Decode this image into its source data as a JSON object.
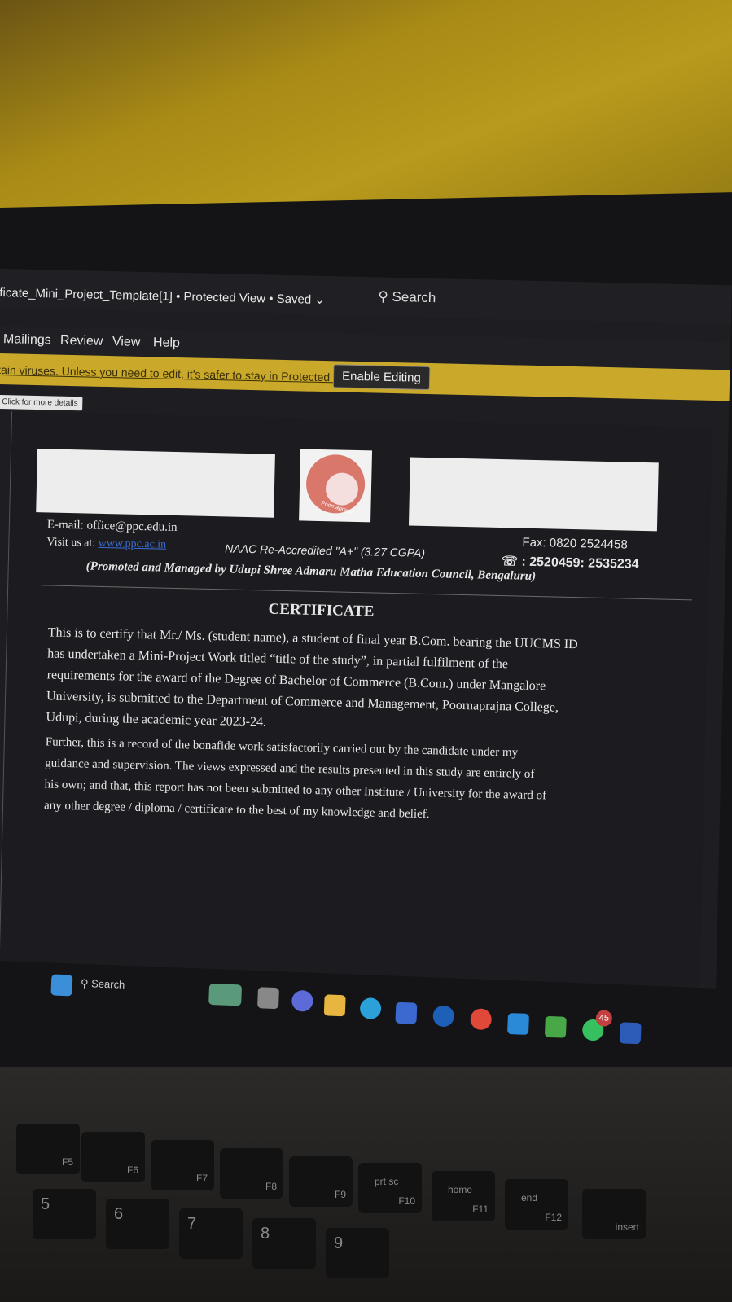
{
  "window": {
    "doc_title": "ficate_Mini_Project_Template[1]",
    "view_mode": "Protected View",
    "save_status": "Saved",
    "search_label": "Search"
  },
  "ribbon": {
    "tabs": [
      "Mailings",
      "Review",
      "View",
      "Help"
    ]
  },
  "protected_bar": {
    "message": "tain viruses. Unless you need to edit, it's safer to stay in Protected View.",
    "enable_button": "Enable Editing"
  },
  "tooltip": "Click for more details",
  "letterhead": {
    "email": "E-mail: office@ppc.edu.in",
    "visit_prefix": "Visit us at:",
    "website": "www.ppc.ac.in",
    "naac": "NAAC Re-Accredited \"A+\" (3.27 CGPA)",
    "fax": "Fax: 0820 2524458",
    "phone": ": 2520459: 2535234",
    "promoted": "(Promoted and Managed by Udupi Shree Admaru Matha Education Council, Bengaluru)",
    "seal_text": "Poornaprajna"
  },
  "certificate": {
    "title": "CERTIFICATE",
    "para1_lines": [
      "This is to certify that Mr./ Ms. (student name), a student of final year B.Com. bearing the UUCMS ID",
      "has undertaken a Mini-Project Work titled “title of the study”, in partial fulfilment of the",
      "requirements for the award of the Degree of Bachelor of Commerce (B.Com.) under Mangalore",
      "University, is submitted to the Department of Commerce and Management, Poornaprajna College,",
      "Udupi, during the academic year 2023-24."
    ],
    "para2_lines": [
      "Further, this is a record of the bonafide work satisfactorily carried out by the candidate under my",
      "guidance and supervision. The views expressed and the results presented in this study are entirely of",
      "his own; and that, this report has not been submitted to any other Institute / University for the award of",
      "any other degree / diploma / certificate to the best of my knowledge and belief."
    ]
  },
  "taskbar": {
    "search_label": "Search",
    "whatsapp_badge": "45"
  },
  "keyboard": {
    "keys": [
      "F5",
      "F6",
      "F7",
      "F8",
      "F9",
      "prt sc",
      "home",
      "end",
      "insert"
    ],
    "sub": [
      "",
      "",
      "",
      "",
      "",
      "F10",
      "F11",
      "F12",
      ""
    ],
    "number_keys": [
      "5",
      "6",
      "7",
      "8",
      "9"
    ]
  },
  "colors": {
    "wall": "#b89a1c",
    "protected_bar": "#c9a82a",
    "link": "#3a6ed8",
    "seal": "#d8776a"
  }
}
